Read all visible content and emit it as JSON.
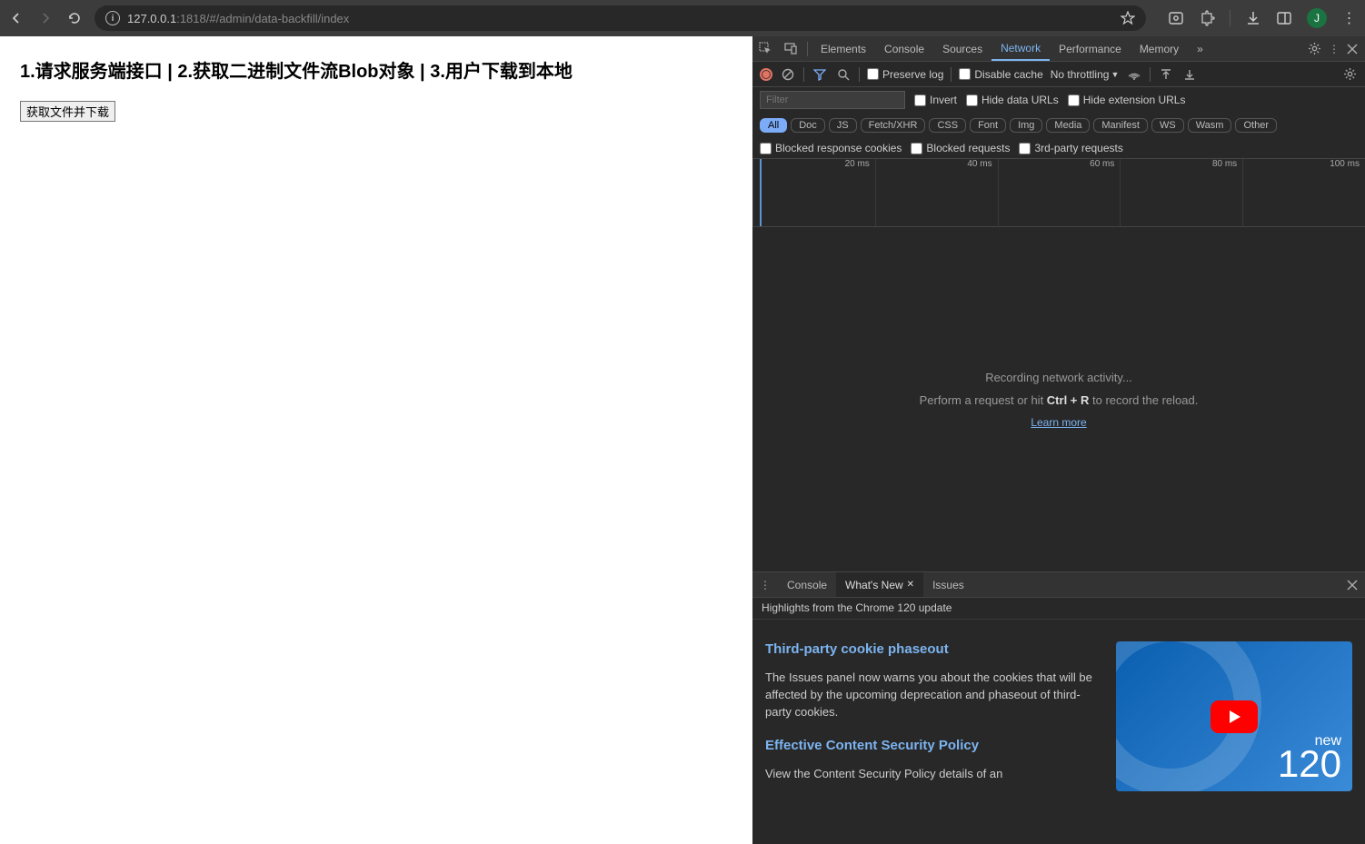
{
  "browser": {
    "url_host": "127.0.0.1",
    "url_path": ":1818/#/admin/data-backfill/index",
    "avatar_letter": "J"
  },
  "page": {
    "title": "1.请求服务端接口 | 2.获取二进制文件流Blob对象 | 3.用户下载到本地",
    "button_label": "获取文件并下载"
  },
  "devtools": {
    "tabs": [
      "Elements",
      "Console",
      "Sources",
      "Network",
      "Performance",
      "Memory"
    ],
    "active_tab": "Network",
    "toolbar": {
      "preserve_log": "Preserve log",
      "disable_cache": "Disable cache",
      "throttling": "No throttling"
    },
    "filter": {
      "placeholder": "Filter",
      "invert": "Invert",
      "hide_data_urls": "Hide data URLs",
      "hide_ext_urls": "Hide extension URLs",
      "chips": [
        "All",
        "Doc",
        "JS",
        "Fetch/XHR",
        "CSS",
        "Font",
        "Img",
        "Media",
        "Manifest",
        "WS",
        "Wasm",
        "Other"
      ],
      "blocked_cookies": "Blocked response cookies",
      "blocked_requests": "Blocked requests",
      "third_party": "3rd-party requests"
    },
    "timeline": [
      "20 ms",
      "40 ms",
      "60 ms",
      "80 ms",
      "100 ms"
    ],
    "body": {
      "recording": "Recording network activity...",
      "hint_prefix": "Perform a request or hit ",
      "hint_key": "Ctrl + R",
      "hint_suffix": " to record the reload.",
      "learn_more": "Learn more"
    }
  },
  "drawer": {
    "tabs": [
      "Console",
      "What's New",
      "Issues"
    ],
    "active_tab": "What's New",
    "highlight": "Highlights from the Chrome 120 update",
    "section1_title": "Third-party cookie phaseout",
    "section1_body": "The Issues panel now warns you about the cookies that will be affected by the upcoming deprecation and phaseout of third-party cookies.",
    "section2_title": "Effective Content Security Policy",
    "section2_body": "View the Content Security Policy details of an",
    "video_new": "new",
    "video_num": "120"
  }
}
